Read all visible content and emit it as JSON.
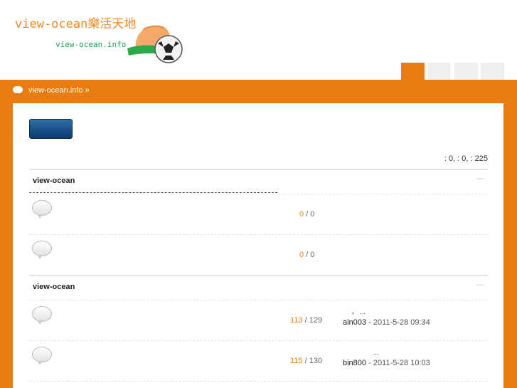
{
  "header": {
    "logo_text": "view-ocean樂活天地",
    "logo_subtext": "view-ocean.info",
    "nav_tabs": [
      "",
      "",
      "",
      ""
    ]
  },
  "breadcrumb": {
    "text": "view-ocean.info »"
  },
  "toolbar": {
    "post_label": ""
  },
  "stats": {
    "text": ": 0,   : 0,   : 225"
  },
  "categories": [
    {
      "title": "view-ocean",
      "collapse_icon": "—",
      "forums": [
        {
          "topics": "0",
          "posts": "0",
          "last_title": "",
          "last_user": "",
          "last_date": ""
        },
        {
          "topics": "0",
          "posts": "0",
          "last_title": "",
          "last_user": "",
          "last_date": ""
        }
      ]
    },
    {
      "title": "view-ocean",
      "collapse_icon": "—",
      "forums": [
        {
          "topics": "113",
          "posts": "129",
          "last_title": "，   …",
          "last_user": "ain003",
          "last_date": " - 2011-5-28 09:34"
        },
        {
          "topics": "115",
          "posts": "130",
          "last_title": "…",
          "last_user": "bin800",
          "last_date": " - 2011-5-28 10:03"
        }
      ]
    }
  ],
  "colors": {
    "brand_orange": "#e87c10",
    "logo_green": "#1aa05a",
    "button_blue": "#0a3c6c"
  },
  "icons": {
    "breadcrumb": "speech-bubble-icon",
    "forum": "speech-bubble-icon",
    "collapse": "minus-icon"
  }
}
